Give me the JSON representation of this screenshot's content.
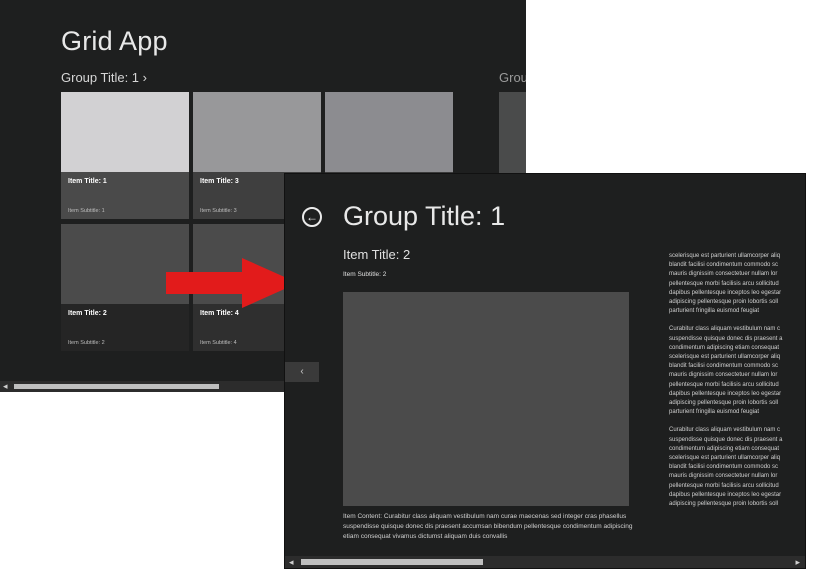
{
  "grid_window": {
    "app_title": "Grid App",
    "group_header": "Group Title: 1 ›",
    "group_header_2": "Grou",
    "tiles": [
      {
        "title": "Item Title: 1",
        "subtitle": "Item Subtitle: 1",
        "image_color": "#d2d1d3",
        "caption_color": "#4a4a4a"
      },
      {
        "title": "Item Title: 3",
        "subtitle": "Item Subtitle: 3",
        "image_color": "#98989a",
        "caption_color": "#3f3f3f"
      },
      {
        "title": "",
        "subtitle": "",
        "image_color": "#8c8c90",
        "caption_color": "#3a3a3a"
      },
      {
        "title": "Item Title: 2",
        "subtitle": "Item Subtitle: 2",
        "image_color": "#4b4b4b",
        "caption_color": "#252525"
      },
      {
        "title": "Item Title: 4",
        "subtitle": "Item Subtitle: 4",
        "image_color": "#4b4b4b",
        "caption_color": "#2f2f2f"
      }
    ]
  },
  "detail_window": {
    "page_title": "Group Title: 1",
    "item_title": "Item Title: 2",
    "item_subtitle": "Item Subtitle: 2",
    "item_content": "Item Content: Curabitur class aliquam vestibulum nam curae maecenas sed integer cras phasellus suspendisse quisque donec dis praesent accumsan bibendum pellentesque condimentum adipiscing etiam consequat vivamus dictumst aliquam duis convallis",
    "side_paragraphs": [
      "scelerisque est parturient ullamcorper aliq\nblandit facilisi condimentum commodo sc\nmauris dignissim consectetuer nullam lor\npellentesque morbi facilisis arcu sollicitud\ndapibus pellentesque inceptos leo egestar\nadipiscing pellentesque proin lobortis soll\nparturient fringilla euismod feugiat",
      "Curabitur class aliquam vestibulum nam c\nsuspendisse quisque donec dis praesent a\ncondimentum adipiscing etiam consequat\nscelerisque est parturient ullamcorper aliq\nblandit facilisi condimentum commodo sc\nmauris dignissim consectetuer nullam lor\npellentesque morbi facilisis arcu sollicitud\ndapibus pellentesque inceptos leo egestar\nadipiscing pellentesque proin lobortis soll\nparturient fringilla euismod feugiat",
      "Curabitur class aliquam vestibulum nam c\nsuspendisse quisque donec dis praesent a\ncondimentum adipiscing etiam consequat\nscelerisque est parturient ullamcorper aliq\nblandit facilisi condimentum commodo sc\nmauris dignissim consectetuer nullam lor\npellentesque morbi facilisis arcu sollicitud\ndapibus pellentesque inceptos leo egestar\nadipiscing pellentesque proin lobortis soll"
    ]
  },
  "icons": {
    "back": "back-arrow-icon",
    "prev": "chevron-left-icon",
    "scroll_left": "scroll-left-icon",
    "scroll_right": "scroll-right-icon",
    "transition": "red-arrow-icon"
  },
  "colors": {
    "background": "#1e1f1f",
    "arrow_red": "#e21b1b"
  }
}
